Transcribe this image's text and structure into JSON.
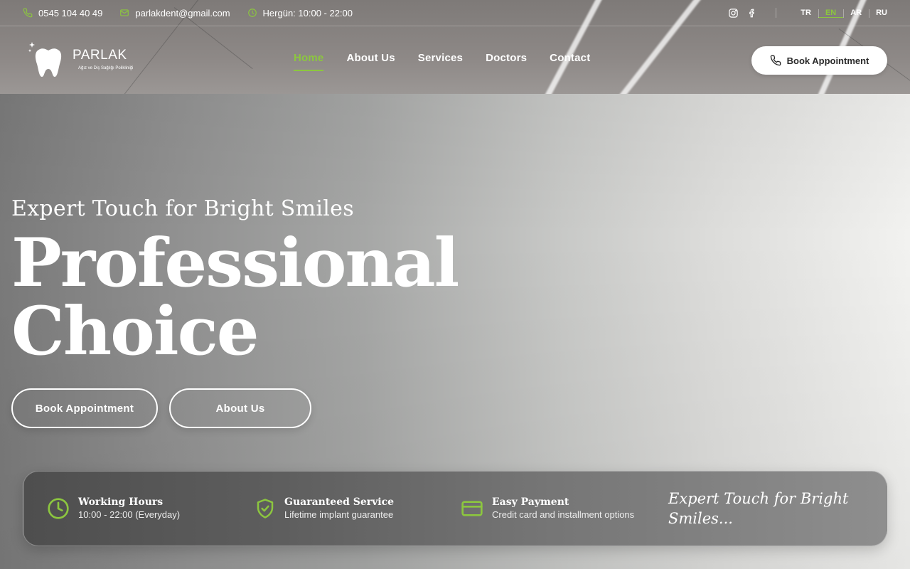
{
  "colors": {
    "accent": "#8cc63f",
    "white": "#ffffff",
    "dark_text": "#2a2a2a"
  },
  "topbar": {
    "phone": "0545 104 40 49",
    "email": "parlakdent@gmail.com",
    "hours": "Hergün: 10:00 - 22:00",
    "social": [
      "instagram-icon",
      "facebook-icon"
    ],
    "languages": [
      {
        "code": "TR",
        "active": false
      },
      {
        "code": "EN",
        "active": true
      },
      {
        "code": "AR",
        "active": false
      },
      {
        "code": "RU",
        "active": false
      }
    ]
  },
  "logo": {
    "brand": "PARLAK",
    "tagline": "Ağız ve Diş Sağlığı Polikliniği"
  },
  "nav": {
    "items": [
      {
        "label": "Home",
        "active": true
      },
      {
        "label": "About Us",
        "active": false
      },
      {
        "label": "Services",
        "active": false
      },
      {
        "label": "Doctors",
        "active": false
      },
      {
        "label": "Contact",
        "active": false
      }
    ],
    "cta": "Book Appointment"
  },
  "hero": {
    "subtitle": "Expert Touch for Bright Smiles",
    "title_line1": "Professional",
    "title_line2": "Choice",
    "primary_button": "Book Appointment",
    "secondary_button": "About Us"
  },
  "features": {
    "items": [
      {
        "icon": "clock-icon",
        "title": "Working Hours",
        "desc": "10:00 - 22:00 (Everyday)"
      },
      {
        "icon": "shield-check-icon",
        "title": "Guaranteed Service",
        "desc": "Lifetime implant guarantee"
      },
      {
        "icon": "credit-card-icon",
        "title": "Easy Payment",
        "desc": "Credit card and installment options"
      }
    ],
    "tagline": "Expert Touch for Bright Smiles..."
  }
}
